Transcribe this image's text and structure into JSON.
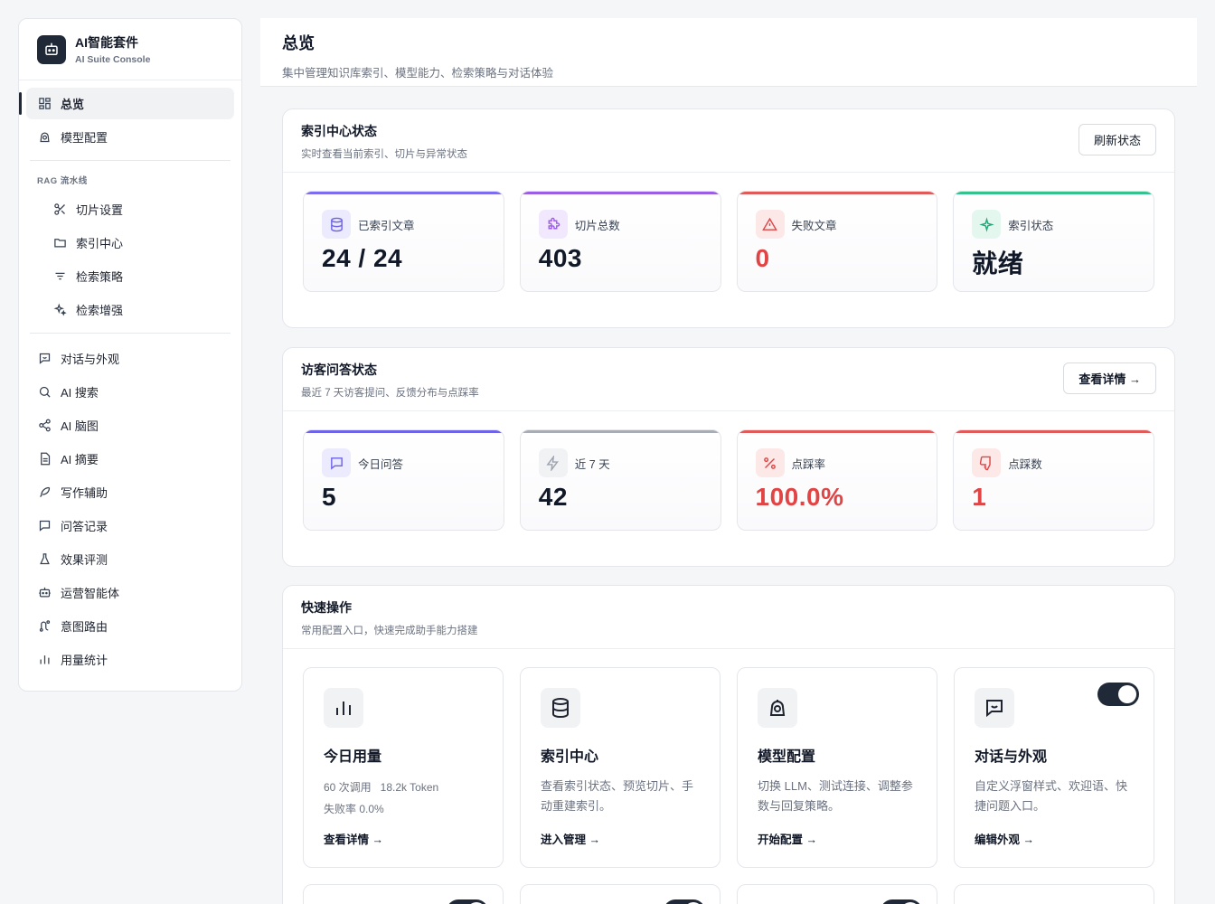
{
  "brand": {
    "title": "AI智能套件",
    "subtitle": "AI Suite Console"
  },
  "sidebar": {
    "top_items": [
      {
        "label": "总览",
        "icon": "grid-icon",
        "active": true
      },
      {
        "label": "模型配置",
        "icon": "model-icon"
      }
    ],
    "section_label": "RAG 流水线",
    "rag_items": [
      {
        "label": "切片设置",
        "icon": "scissors-icon"
      },
      {
        "label": "索引中心",
        "icon": "folder-icon"
      },
      {
        "label": "检索策略",
        "icon": "filter-icon"
      },
      {
        "label": "检索增强",
        "icon": "sparkle-icon"
      }
    ],
    "bottom_items": [
      {
        "label": "对话与外观",
        "icon": "chat-window-icon"
      },
      {
        "label": "AI 搜索",
        "icon": "search-icon"
      },
      {
        "label": "AI 脑图",
        "icon": "share-nodes-icon"
      },
      {
        "label": "AI 摘要",
        "icon": "document-icon"
      },
      {
        "label": "写作辅助",
        "icon": "feather-icon"
      },
      {
        "label": "问答记录",
        "icon": "message-icon"
      },
      {
        "label": "效果评测",
        "icon": "flask-icon"
      },
      {
        "label": "运营智能体",
        "icon": "robot-icon"
      },
      {
        "label": "意图路由",
        "icon": "route-icon"
      },
      {
        "label": "用量统计",
        "icon": "bar-chart-icon"
      }
    ]
  },
  "header": {
    "title": "总览",
    "subtitle": "集中管理知识库索引、模型能力、检索策略与对话体验"
  },
  "index_card": {
    "title": "索引中心状态",
    "subtitle": "实时查看当前索引、切片与异常状态",
    "button": "刷新状态",
    "stats": [
      {
        "label": "已索引文章",
        "value": "24 / 24",
        "accent": "#7c6cf0",
        "icon_bg": "#eceafd",
        "value_color": "#111827",
        "icon": "database-icon"
      },
      {
        "label": "切片总数",
        "value": "403",
        "accent": "#9b5de5",
        "icon_bg": "#f1e8fd",
        "value_color": "#111827",
        "icon": "puzzle-icon"
      },
      {
        "label": "失败文章",
        "value": "0",
        "accent": "#e05a5a",
        "icon_bg": "#fde8e8",
        "value_color": "#e04444",
        "icon": "warning-icon"
      },
      {
        "label": "索引状态",
        "value": "就绪",
        "accent": "#34c38f",
        "icon_bg": "#e3f7ef",
        "value_color": "#111827",
        "icon": "sparkle-icon"
      }
    ]
  },
  "visitor_card": {
    "title": "访客问答状态",
    "subtitle": "最近 7 天访客提问、反馈分布与点踩率",
    "button": "查看详情 →",
    "stats": [
      {
        "label": "今日问答",
        "value": "5",
        "accent": "#6d63e6",
        "icon_bg": "#eceafd",
        "value_color": "#111827",
        "icon": "message-square-icon"
      },
      {
        "label": "近 7 天",
        "value": "42",
        "accent": "#a8acb3",
        "icon_bg": "#f1f2f4",
        "value_color": "#111827",
        "icon": "lightning-icon"
      },
      {
        "label": "点踩率",
        "value": "100.0%",
        "accent": "#e05a5a",
        "icon_bg": "#fde8e8",
        "value_color": "#e04444",
        "icon": "percent-icon"
      },
      {
        "label": "点踩数",
        "value": "1",
        "accent": "#e05a5a",
        "icon_bg": "#fde8e8",
        "value_color": "#e04444",
        "icon": "thumbs-down-icon"
      }
    ]
  },
  "quick_card": {
    "title": "快速操作",
    "subtitle": "常用配置入口，快速完成助手能力搭建",
    "items": [
      {
        "title": "今日用量",
        "meta_line1": "60 次调用   18.2k Token",
        "meta_line2": "失败率 0.0%",
        "link": "查看详情 →",
        "icon": "bar-chart-icon",
        "toggle": false
      },
      {
        "title": "索引中心",
        "desc": "查看索引状态、预览切片、手动重建索引。",
        "link": "进入管理 →",
        "icon": "database-icon",
        "toggle": false
      },
      {
        "title": "模型配置",
        "desc": "切换 LLM、测试连接、调整参数与回复策略。",
        "link": "开始配置 →",
        "icon": "model-icon",
        "toggle": false
      },
      {
        "title": "对话与外观",
        "desc": "自定义浮窗样式、欢迎语、快捷问题入口。",
        "link": "编辑外观 →",
        "icon": "chat-window-icon",
        "toggle": true
      }
    ]
  }
}
